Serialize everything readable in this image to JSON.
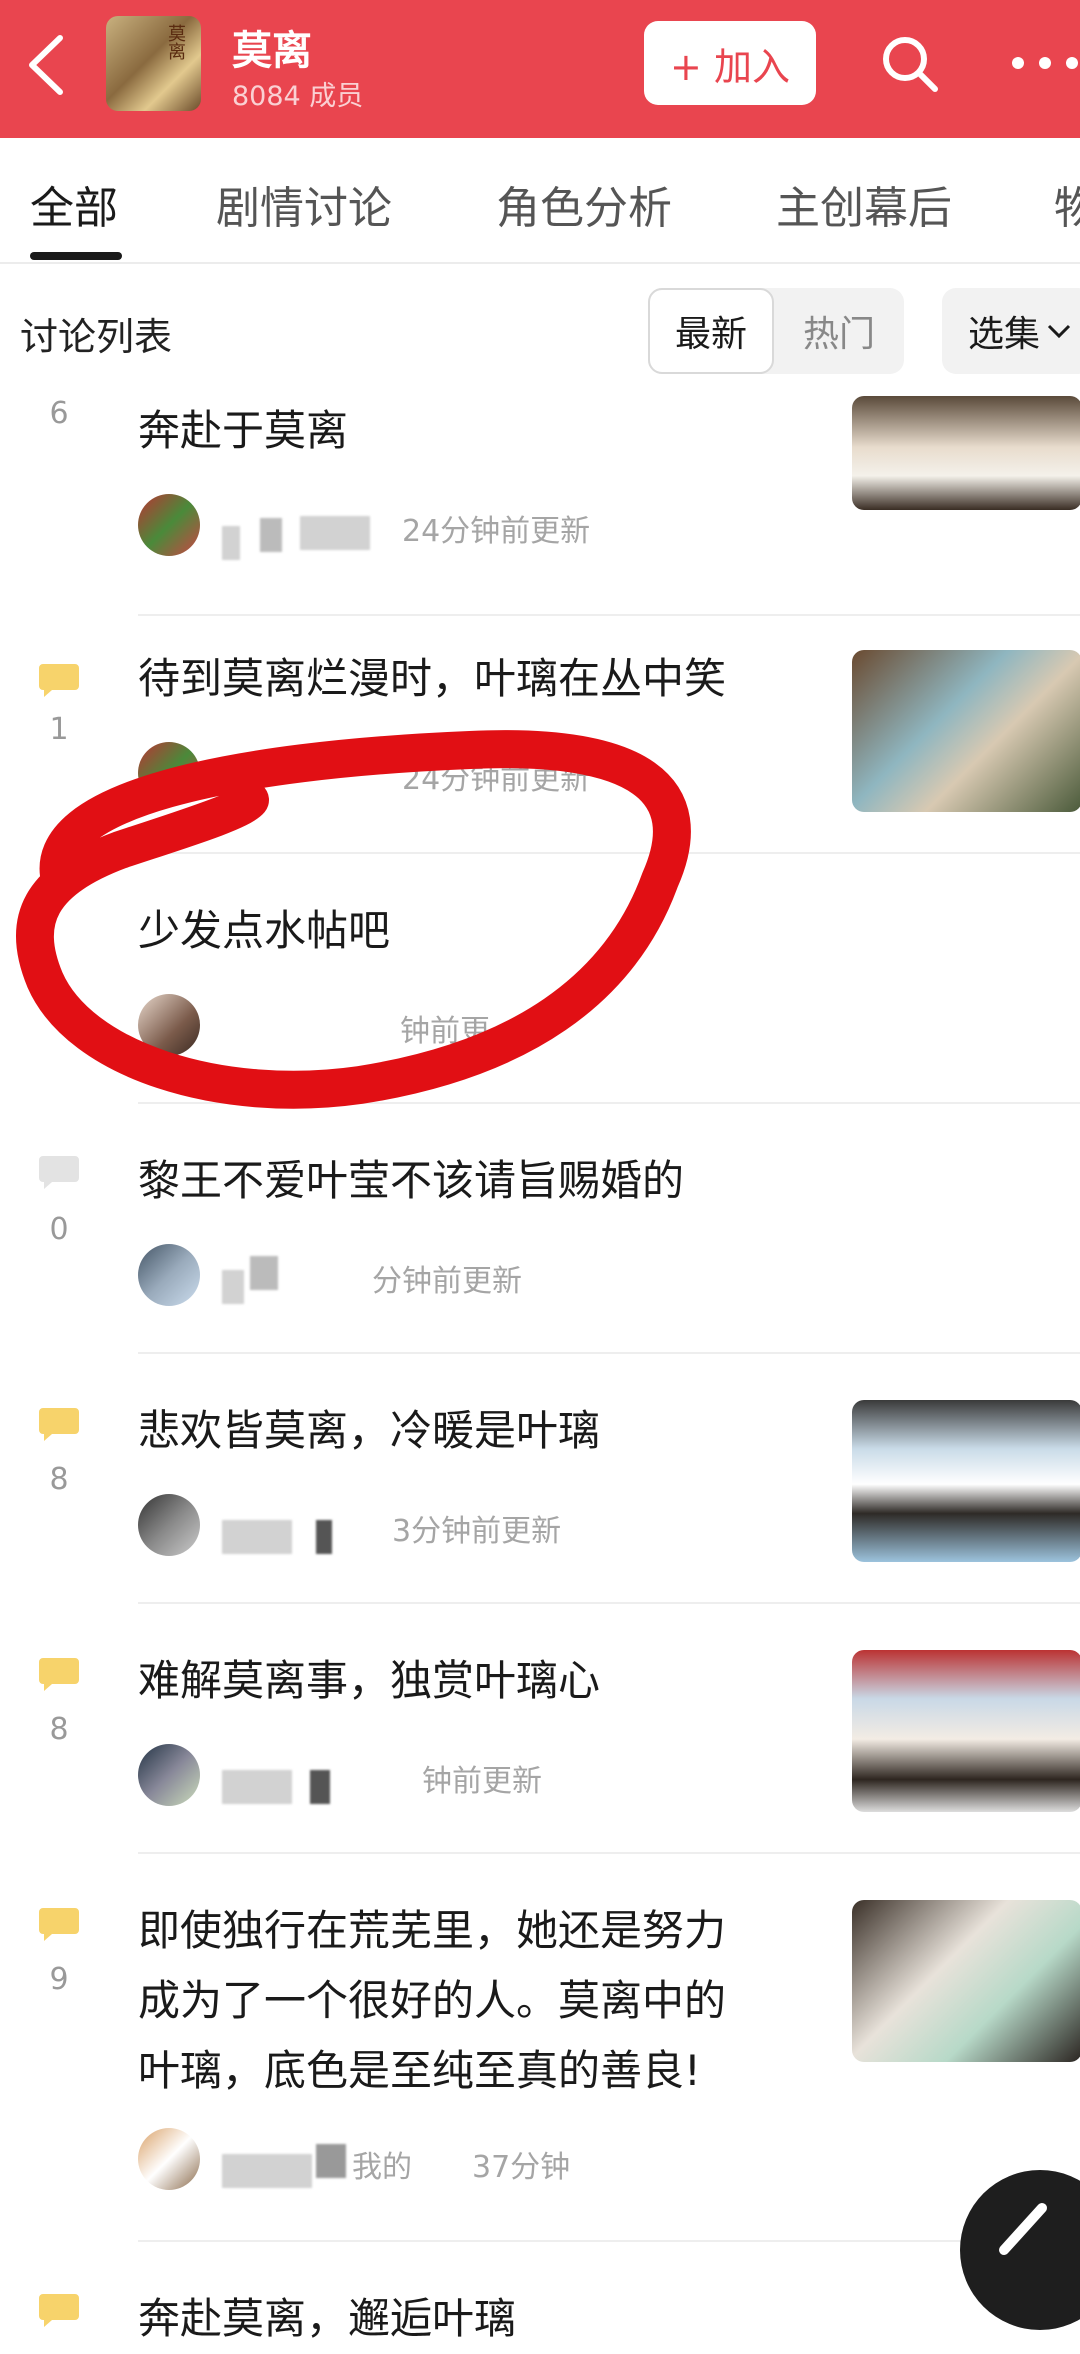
{
  "header": {
    "group_name": "莫离",
    "member_count": "8084 成员",
    "avatar_text": "莫离",
    "join_label": "+ 加入",
    "accent_color": "#e9454f"
  },
  "tabs": [
    "全部",
    "剧情讨论",
    "角色分析",
    "主创幕后",
    "物"
  ],
  "list": {
    "title": "讨论列表",
    "sort_options": [
      "最新",
      "热门"
    ],
    "selected_sort": "最新",
    "episode_label": "选集"
  },
  "posts": [
    {
      "count": "6",
      "title": "奔赴于莫离",
      "time": "24分钟前更新",
      "has_bubble": false
    },
    {
      "count": "1",
      "title": "待到莫离烂漫时，叶璃在丛中笑",
      "time": "24分钟前更新",
      "has_bubble": true
    },
    {
      "count": "",
      "title": "少发点水帖吧",
      "time": "钟前更",
      "has_bubble": false
    },
    {
      "count": "0",
      "title": "黎王不爱叶莹不该请旨赐婚的",
      "time": "分钟前更新",
      "has_bubble": true
    },
    {
      "count": "8",
      "title": "悲欢皆莫离，冷暖是叶璃",
      "time": "3分钟前更新",
      "has_bubble": true
    },
    {
      "count": "8",
      "title": "难解莫离事，独赏叶璃心",
      "time": "钟前更新",
      "has_bubble": true
    },
    {
      "count": "9",
      "title_lines": [
        "即使独行在荒芜里，她还是努力",
        "成为了一个很好的人。莫离中的",
        "叶璃，底色是至纯至真的善良!"
      ],
      "time": "37分钟",
      "name_fragment": "我的",
      "has_bubble": true
    },
    {
      "count": "",
      "title": "奔赴莫离，邂逅叶璃",
      "time": "",
      "has_bubble": true
    }
  ],
  "icons": {
    "back": "chevron-left-icon",
    "search": "search-icon",
    "more": "more-dots-icon",
    "comment": "comment-bubble-icon",
    "compose": "pen-icon"
  }
}
